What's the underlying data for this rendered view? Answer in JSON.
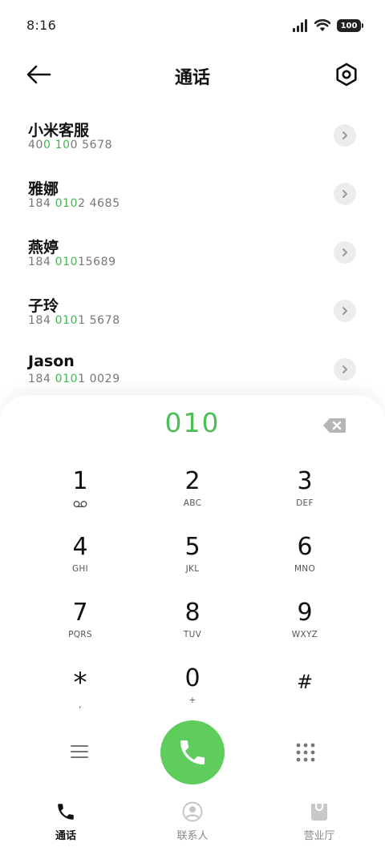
{
  "status_bar": {
    "time": "8:16",
    "battery": "100"
  },
  "header": {
    "title": "通话"
  },
  "results": [
    {
      "name": "小米客服",
      "number_parts": [
        "40",
        "0 10",
        "0 5678"
      ]
    },
    {
      "name": "雅娜",
      "number_parts": [
        "184 ",
        "010",
        "2 4685"
      ]
    },
    {
      "name": "燕婷",
      "number_parts": [
        "184 ",
        "010",
        "15689"
      ]
    },
    {
      "name": "子玲",
      "number_parts": [
        "184 ",
        "010",
        "1 5678"
      ]
    },
    {
      "name": "Jason",
      "number_parts": [
        "184 ",
        "010",
        "1 0029"
      ]
    }
  ],
  "dialpad": {
    "input": "010",
    "keys": [
      {
        "digit": "1",
        "letters": ""
      },
      {
        "digit": "2",
        "letters": "ABC"
      },
      {
        "digit": "3",
        "letters": "DEF"
      },
      {
        "digit": "4",
        "letters": "GHI"
      },
      {
        "digit": "5",
        "letters": "JKL"
      },
      {
        "digit": "6",
        "letters": "MNO"
      },
      {
        "digit": "7",
        "letters": "PQRS"
      },
      {
        "digit": "8",
        "letters": "TUV"
      },
      {
        "digit": "9",
        "letters": "WXYZ"
      },
      {
        "digit": "*",
        "letters": ","
      },
      {
        "digit": "0",
        "letters": "+"
      },
      {
        "digit": "#",
        "letters": ""
      }
    ]
  },
  "bottom_nav": {
    "calls": "通话",
    "contacts": "联系人",
    "store": "营业厅"
  },
  "colors": {
    "accent_green": "#4bbe55",
    "call_button": "#5fcd5c",
    "text_dark": "#111111"
  },
  "icons": {
    "back": "arrow-left-icon",
    "settings": "hexagon-settings-icon",
    "detail": "chevron-right-icon",
    "backspace": "backspace-icon",
    "voicemail": "voicemail-icon",
    "menu": "menu-icon",
    "call": "phone-icon",
    "keypad": "keypad-icon",
    "contacts": "person-icon",
    "store": "bag-icon"
  }
}
